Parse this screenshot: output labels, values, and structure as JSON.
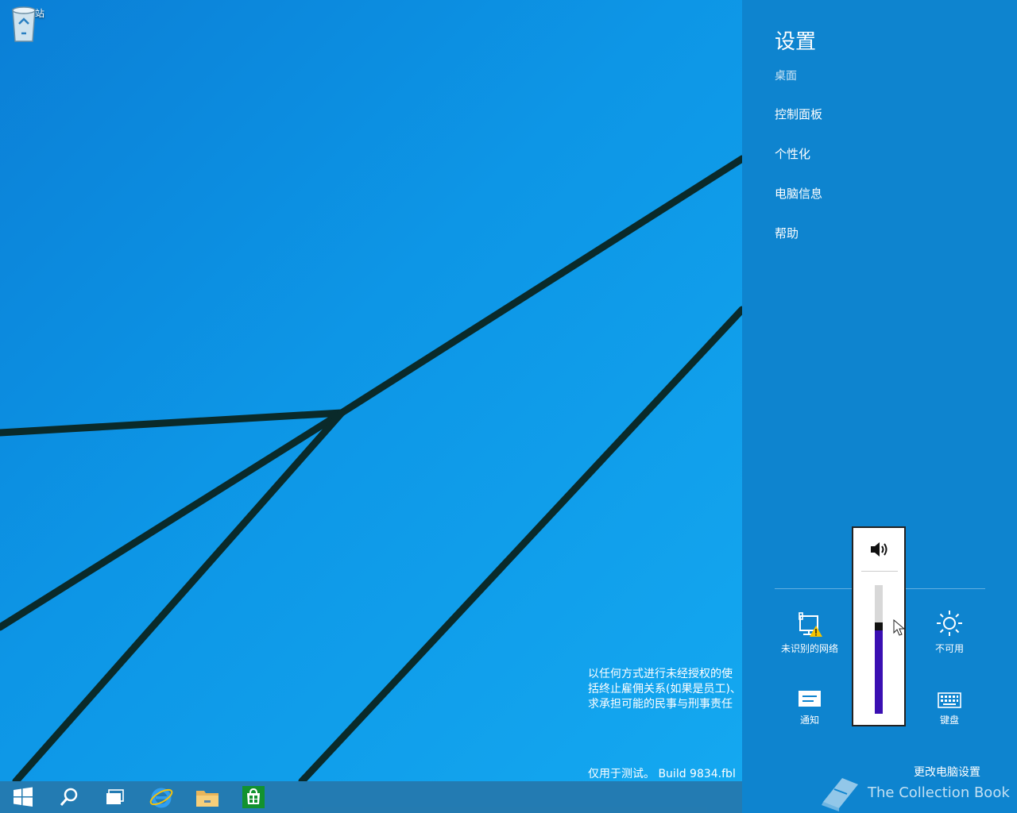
{
  "desktop": {
    "recycle_bin_label": "回收站",
    "watermark_lines": [
      "以任何方式进行未经授权的使",
      "括终止雇佣关系(如果是员工)、",
      "求承担可能的民事与刑事责任"
    ],
    "build_text": "仅用于测试。 Build 9834.fbl"
  },
  "taskbar": {
    "items": [
      "start-icon",
      "search-icon",
      "task-view-icon",
      "internet-explorer-icon",
      "file-explorer-icon",
      "store-icon"
    ]
  },
  "charm": {
    "title": "设置",
    "subtitle": "桌面",
    "menu": [
      "控制面板",
      "个性化",
      "电脑信息",
      "帮助"
    ],
    "quick": {
      "network_label": "未识别的网络",
      "brightness_label": "不可用",
      "notifications_label": "通知",
      "keyboard_label": "键盘"
    },
    "change_pc_settings": "更改电脑设置",
    "watermark_brand": "The Collection Book"
  },
  "volume": {
    "level": 0.66,
    "icon": "speaker-icon"
  },
  "colors": {
    "charm_bg": "#0e84cf",
    "volume_fill": "#3a0fb2"
  }
}
